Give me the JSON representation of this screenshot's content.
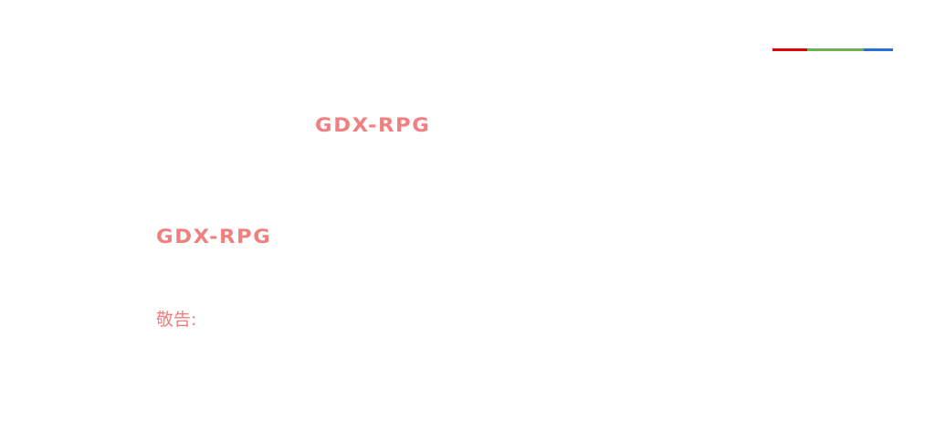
{
  "colors": {
    "accent_text": "#f08080",
    "bar_red": "#e00000",
    "bar_green": "#6ab04c",
    "bar_blue": "#2a6fd6"
  },
  "header": {
    "title": "GDX-RPG"
  },
  "main": {
    "heading": "GDX-RPG",
    "notice_label": "敬告:"
  }
}
